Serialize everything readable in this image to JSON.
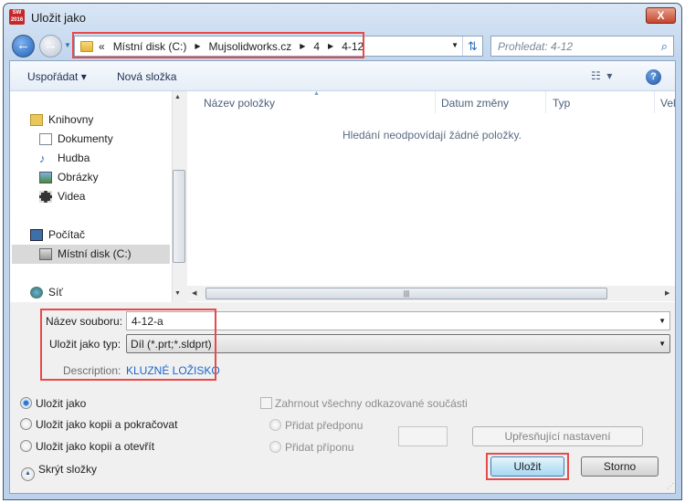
{
  "window": {
    "title": "Uložit jako",
    "app_icon_text": "SW 2016",
    "close_label": "X"
  },
  "navigation": {
    "back": "back-icon",
    "forward": "forward-icon",
    "address": {
      "prefix": "«",
      "crumbs": [
        "Místní disk (C:)",
        "Mujsolidworks.cz",
        "4",
        "4-12"
      ]
    },
    "search_placeholder": "Prohledat: 4-12"
  },
  "toolbar": {
    "organize": "Uspořádat ▾",
    "new_folder": "Nová složka"
  },
  "sidebar": {
    "libraries": "Knihovny",
    "items": [
      "Dokumenty",
      "Hudba",
      "Obrázky",
      "Videa"
    ],
    "computer": "Počítač",
    "local_disk": "Místní disk (C:)",
    "network": "Síť"
  },
  "file_list": {
    "columns": [
      "Název položky",
      "Datum změny",
      "Typ",
      "Vel"
    ],
    "empty_message": "Hledání neodpovídají žádné položky."
  },
  "form": {
    "filename_label": "Název souboru:",
    "filename_value": "4-12-a",
    "type_label": "Uložit jako typ:",
    "type_value": "Díl (*.prt;*.sldprt)",
    "description_label": "Description:",
    "description_value": "KLUZNÉ LOŽISKO"
  },
  "options": {
    "save_modes": [
      "Uložit jako",
      "Uložit jako kopii a pokračovat",
      "Uložit jako kopii a otevřít"
    ],
    "selected_mode": "Uložit jako",
    "include_refs": "Zahrnout všechny odkazované součásti",
    "add_prefix": "Přidat předponu",
    "add_suffix": "Přidat příponu",
    "advanced": "Upřesňující nastavení",
    "hide_folders": "Skrýt složky"
  },
  "buttons": {
    "save": "Uložit",
    "cancel": "Storno"
  },
  "colors": {
    "highlight": "#e84a4a",
    "link": "#1a66cc"
  }
}
